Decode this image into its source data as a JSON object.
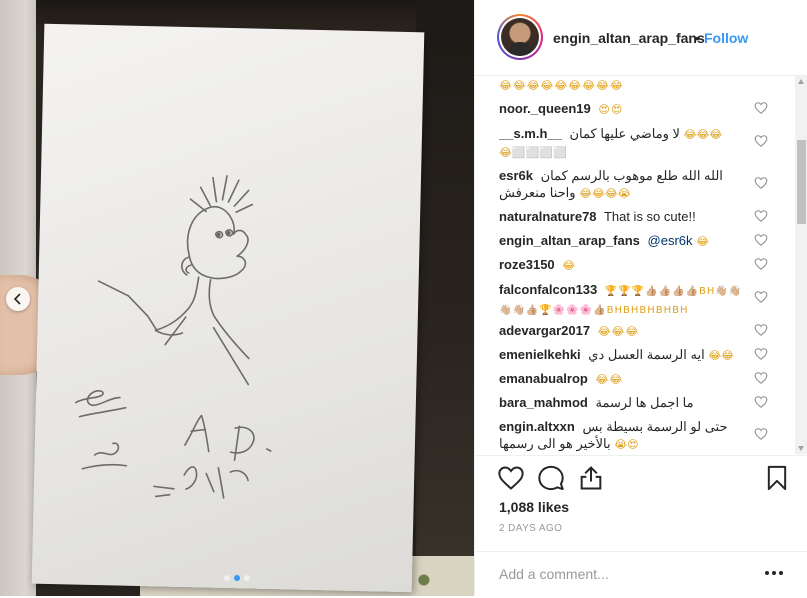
{
  "post": {
    "username": "engin_altan_arap_fans",
    "separator": "•",
    "follow_label": "Follow",
    "likes": "1,088 likes",
    "timestamp": "2 DAYS AGO",
    "carousel": {
      "total_slides": 3,
      "active_slide": 2
    }
  },
  "comments": [
    {
      "user": "",
      "text": "",
      "emoji": "😂😂😂😂😂😂😂😂😂"
    },
    {
      "user": "noor._queen19",
      "text": "",
      "emoji": "😍😍"
    },
    {
      "user": "__s.m.h__",
      "text": "لا وماضي عليها كمان",
      "emoji": "😂😂😂",
      "line2_emoji": "😂⬜⬜⬜⬜"
    },
    {
      "user": "esr6k",
      "text": "الله الله طلع موهوب بالرسم كمان",
      "line2_text": "واحنا منعرفش",
      "emoji": "😂😂😂😭"
    },
    {
      "user": "naturalnature78",
      "text": "That is so cute!!",
      "emoji": ""
    },
    {
      "user": "engin_altan_arap_fans",
      "mention": "@esr6k",
      "emoji": "😂"
    },
    {
      "user": "roze3150",
      "text": "",
      "emoji": "😂"
    },
    {
      "user": "falconfalcon133",
      "text": "🏆🏆🏆👍🏼👍🏼👍🏼👍🏼BH👋🏼👋🏼",
      "line2_text": "👋🏼👋🏼👍🏼🏆🌸🌸🌸👍🏼BHBHBHBHBH",
      "emoji": ""
    },
    {
      "user": "adevargar2017",
      "text": "",
      "emoji": "😂😂😂"
    },
    {
      "user": "emenielkehki",
      "text": "ايه الرسمة العسل دي",
      "emoji": "😂😂"
    },
    {
      "user": "emanabualrop",
      "text": "",
      "emoji": "😂😂"
    },
    {
      "user": "bara_mahmod",
      "text": "ما اجمل ها لرسمة",
      "emoji": ""
    },
    {
      "user": "engin.altxxn",
      "text": "حتى لو الرسمة بسيطة بس",
      "line2_text": "بالأخير هو الى رسمها",
      "emoji": "😭😍"
    }
  ],
  "composer": {
    "placeholder": "Add a comment..."
  },
  "icons": {
    "like": "heart-icon",
    "comment": "comment-bubble-icon",
    "share": "share-icon",
    "save": "bookmark-icon",
    "more": "more-options-icon",
    "prev": "chevron-left-icon"
  },
  "colors": {
    "accent": "#3897f0",
    "text": "#262626",
    "muted": "#999999",
    "border": "#efefef"
  }
}
